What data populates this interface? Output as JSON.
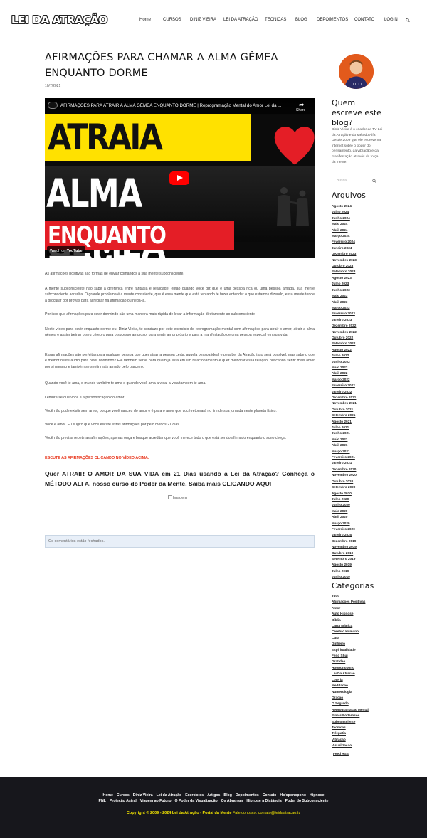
{
  "header": {
    "logo": "LEI DA ATRAÇÃO",
    "nav": [
      "Home",
      "CURSOS",
      "DINIZ VIEIRA",
      "LEI DA ATRAÇÃO",
      "TECNICAS",
      "BLOG",
      "DEPOIMENTOS",
      "CONTATO",
      "LOGIN"
    ]
  },
  "post": {
    "title": "AFIRMAÇÕES PARA CHAMAR A ALMA GÊMEA ENQUANTO DORME",
    "date": "10/7/2021",
    "video": {
      "title": "AFIRMAÇÕES PARA ATRAIR A ALMA GÊMEA ENQUANTO DORME | Reprogramação Mental do Amor Lei da ...",
      "share": "Share",
      "line1": "ATRAIA SUA",
      "line2": "ALMA GÊMEA",
      "line3": "ENQUANTO DORME",
      "watch_on": "Watch on",
      "youtube": "YouTube"
    },
    "paragraphs": [
      "As afirmações positivas são formas de enviar comandos à sua mente subconsciente.",
      "A mente subconsciente não sabe a diferença entre fantasia e realidade, então quando você diz que é uma pessoa rica ou uma pessoa amada, sua mente subconsciente acredita. O grande problema é a mente consciente, que é essa mente que está tentando te fazer entender o que estamos dizendo, essa mente tende a procurar por provas para acreditar na afirmação ou negá-la.",
      "Por isso que afirmações para ouvir dormindo são uma maneira mais rápida de levar a informação diretamente ao subconsciente.",
      "Neste vídeo para ouvir enquanto dorme eu, Diniz Vieira, te conduzo por este exercício de reprogramação mental com afirmações para atrair o amor, atrair a alma gêmea e assim treinar o seu cérebro para o sucesso amoroso, para sentir amor próprio e para a manifestação de uma pessoa especial em sua vida.",
      "Essas afirmações são perfeitas para qualquer pessoa que quer atrair a pessoa certa, aquela pessoa ideal e pela Lei da Atração isso será possível, mas sabe o que é melhor neste áudio para ouvir dormindo? Ele também serve para quem já está em um relacionamento e quer melhorar essa relação, buscando sentir mais amor por si mesmo e também se sentir mais amado pelo parceiro.",
      "Quando você te ama, o mundo também te ama e quando você ama a vida, a vida também te ama.",
      "Lembre-se que você é a personificação do amor.",
      "Você não pode existir sem amor, porque você nasceu do amor e é para o amor que você retornará no fim de sua jornada neste planeta físico.",
      "Você é amor. Eu sugiro que você escute estas afirmações por pelo menos 21 dias.",
      "Você não precisa repetir as afirmações, apenas ouça e busque acreditar que você merece tudo o que está sendo afirmado enquanto o sono chega."
    ],
    "red_notice": "ESCUTE AS AFIRMAÇÕES CLICANDO NO VÍDEO ACIMA.",
    "cta": "Quer ATRAIR O AMOR DA SUA VIDA em 21 Dias usando a Lei da Atração? Conheça o MÉTODO ALFA, nosso curso do Poder da Mente. Saiba mais CLICANDO AQUI",
    "image_alt": "Imagem",
    "comments_closed": "Os comentários estão fechados."
  },
  "sidebar": {
    "about_title": "Quem escreve este blog?",
    "about_text": "Diniz Vieira é o criador da TV Lei da Atração e do Método Alfa. Desde 2009 que ele escreve na internet sobre o poder do pensamento, da vibração e da manifestação através da força da mente.",
    "search_placeholder": "Busca",
    "archives_title": "Arquivos",
    "archives": [
      "Agosto 2024",
      "Julho 2024",
      "Junho 2024",
      "Maio 2024",
      "Abril 2024",
      "Março 2024",
      "Fevereiro 2024",
      "Janeiro 2024",
      "Dezembro 2023",
      "Novembro 2023",
      "Outubro 2023",
      "Setembro 2023",
      "Agosto 2023",
      "Julho 2023",
      "Junho 2023",
      "Maio 2023",
      "Abril 2023",
      "Março 2023",
      "Fevereiro 2023",
      "Janeiro 2023",
      "Dezembro 2022",
      "Novembro 2022",
      "Outubro 2022",
      "Setembro 2022",
      "Agosto 2022",
      "Julho 2022",
      "Junho 2022",
      "Maio 2022",
      "Abril 2022",
      "Março 2022",
      "Fevereiro 2022",
      "Janeiro 2022",
      "Dezembro 2021",
      "Novembro 2021",
      "Outubro 2021",
      "Setembro 2021",
      "Agosto 2021",
      "Julho 2021",
      "Junho 2021",
      "Maio 2021",
      "Abril 2021",
      "Março 2021",
      "Fevereiro 2021",
      "Janeiro 2021",
      "Dezembro 2020",
      "Novembro 2020",
      "Outubro 2020",
      "Setembro 2020",
      "Agosto 2020",
      "Julho 2020",
      "Junho 2020",
      "Maio 2020",
      "Abril 2020",
      "Março 2020",
      "Fevereiro 2020",
      "Janeiro 2020",
      "Dezembro 2019",
      "Novembro 2019",
      "Outubro 2019",
      "Setembro 2019",
      "Agosto 2019",
      "Julho 2019",
      "Junho 2019"
    ],
    "categories_title": "Categorias",
    "categories": [
      "Tudo",
      "Afirmacoes Positivas",
      "Amor",
      "Auto Hipnose",
      "Bíblia",
      "Carta Mágica",
      "Cerebro Humano",
      "Cura",
      "Dinheiro",
      "Espiritualidade",
      "Feng Shui",
      "Gratidao",
      "Hooponopono",
      "Lei Da Atracao",
      "Loteria",
      "Meditacao",
      "Numerologia",
      "Oracao",
      "O Segredo",
      "Reprogramacao Mental",
      "Sinais Poderosos",
      "Subconsciente",
      "Tecnicas",
      "Telepatia",
      "Vibracao",
      "Visualizacao"
    ],
    "feed": "Feed RSS"
  },
  "footer": {
    "row1": [
      "Home",
      "Cursos",
      "Diniz Vieira",
      "Lei da Atração",
      "Exercícios",
      "Artigos",
      "Blog",
      "Depoimentos",
      "Contato",
      "Ho'oponopono",
      "Hipnose"
    ],
    "row2": [
      "PNL",
      "Projeção Astral",
      "Viagem ao Futuro",
      "O Poder da Visualização",
      "Os Abraham",
      "Hipnose à Distância",
      "Poder do Subconsciente"
    ],
    "copyright": "Copyright © 2009 - 2024 Lei da Atração - Portal da Mente",
    "contact": " Fale conosco: contato@leidaatracao.tv"
  },
  "colors": {
    "accent_red": "#e8361c",
    "footer_bg": "#17171c",
    "footer_copyright": "#f2e400"
  }
}
